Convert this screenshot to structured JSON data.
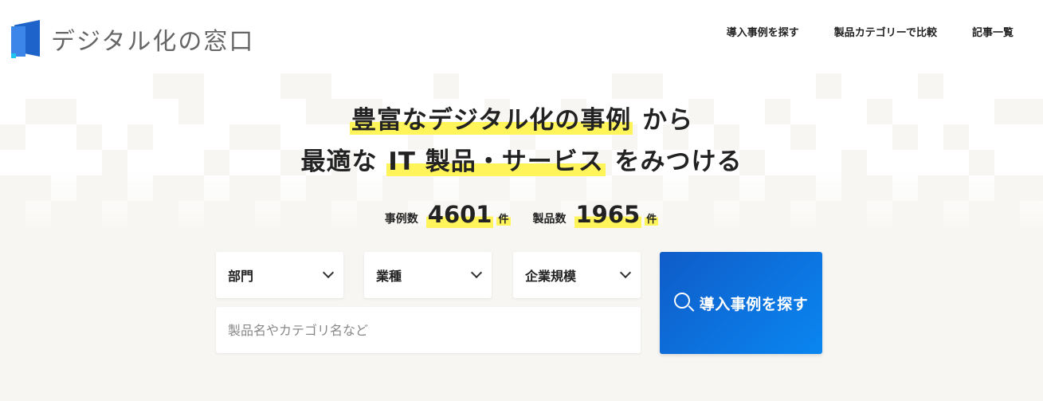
{
  "logo": {
    "text": "デジタル化の窓口",
    "icon": "brand-window-icon",
    "brand_color": "#1e63c9"
  },
  "nav": {
    "items": [
      {
        "label": "導入事例を探す"
      },
      {
        "label": "製品カテゴリーで比較"
      },
      {
        "label": "記事一覧"
      }
    ]
  },
  "hero": {
    "line1_highlight": "豊富なデジタル化の事例",
    "line1_rest": " から",
    "line2_pre": "最適な ",
    "line2_highlight": "IT 製品・サービス",
    "line2_post": " をみつける",
    "highlight_color": "#fff45a"
  },
  "stats": {
    "cases_label": "事例数",
    "cases_value": "4601",
    "cases_unit": "件",
    "products_label": "製品数",
    "products_value": "1965",
    "products_unit": "件"
  },
  "search": {
    "department_label": "部門",
    "industry_label": "業種",
    "company_size_label": "企業規模",
    "keyword_placeholder": "製品名やカテゴリ名など",
    "keyword_value": "",
    "submit_label": "導入事例を探す",
    "submit_icon": "search-icon",
    "button_color": "#0f5cc9"
  }
}
